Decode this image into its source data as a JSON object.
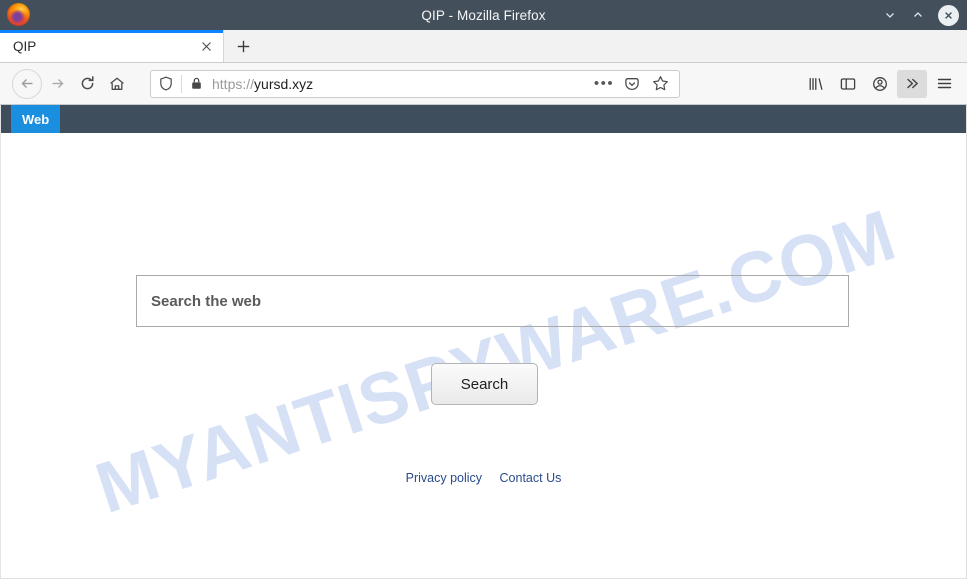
{
  "window": {
    "title": "QIP - Mozilla Firefox",
    "logo_icon": "firefox-logo",
    "controls": {
      "minimize_icon": "chevron-down-icon",
      "maximize_icon": "chevron-up-icon",
      "close_icon": "close-icon"
    }
  },
  "tabstrip": {
    "tabs": [
      {
        "title": "QIP",
        "close_icon": "close-icon",
        "active": true
      }
    ],
    "new_tab_icon": "plus-icon"
  },
  "toolbar": {
    "back_icon": "arrow-left-icon",
    "forward_icon": "arrow-right-icon",
    "reload_icon": "reload-icon",
    "home_icon": "home-icon",
    "urlbar": {
      "shield_icon": "shield-icon",
      "lock_icon": "padlock-icon",
      "scheme": "https://",
      "host": "yursd.xyz",
      "full_url": "https://yursd.xyz",
      "page_actions_icon": "ellipsis-icon",
      "pocket_icon": "pocket-icon",
      "bookmark_icon": "star-icon"
    },
    "library_icon": "library-icon",
    "sidebar_icon": "sidebar-icon",
    "account_icon": "account-icon",
    "overflow_icon": "double-chevron-right-icon",
    "menu_icon": "hamburger-menu-icon"
  },
  "site": {
    "header": {
      "tabs": [
        {
          "label": "Web",
          "active": true
        }
      ]
    },
    "watermark": "MYANTISPYWARE.COM",
    "search": {
      "value": "",
      "placeholder": "Search the web",
      "button_label": "Search"
    },
    "footer": {
      "links": [
        {
          "label": "Privacy policy"
        },
        {
          "label": "Contact Us"
        }
      ]
    }
  },
  "colors": {
    "titlebar_bg": "#43505c",
    "site_header_bg": "#3e4e5c",
    "site_tab_accent": "#1a8fe0",
    "tab_active_accent": "#0a84ff",
    "watermark": "#c8d6f3",
    "link": "#2a4b8d"
  }
}
